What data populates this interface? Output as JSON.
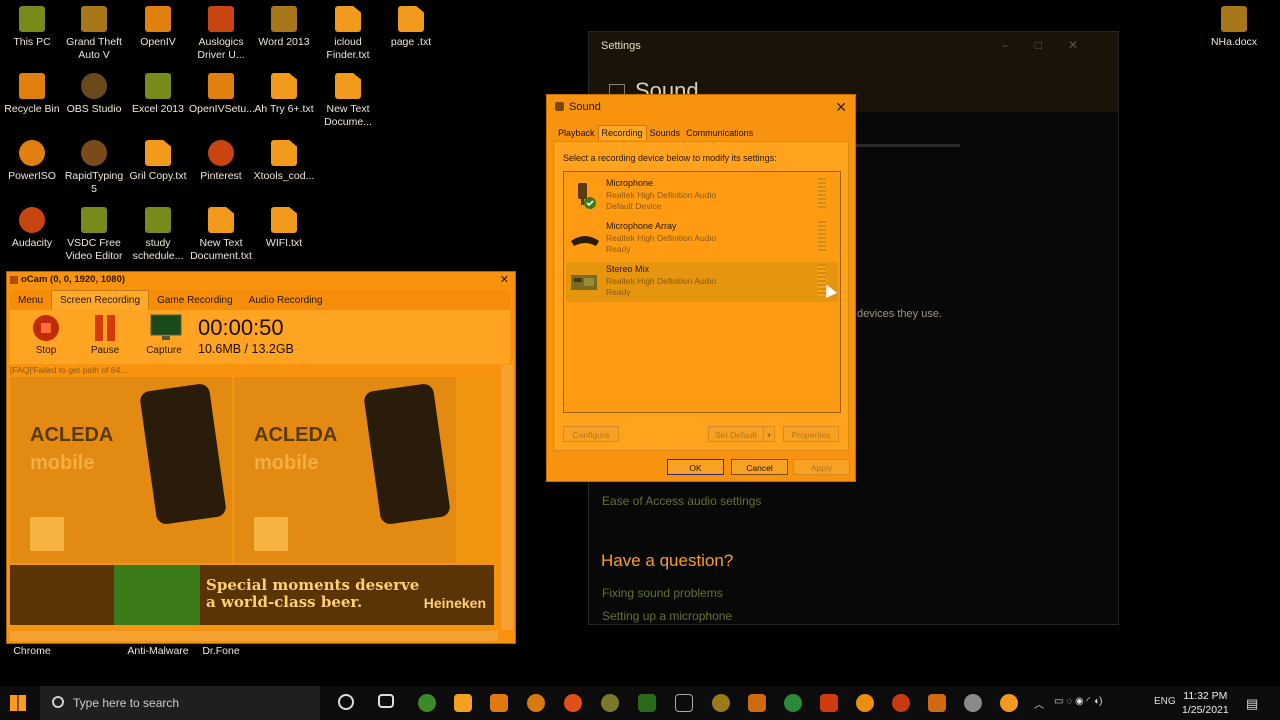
{
  "desktop": {
    "icons": [
      {
        "label": "This PC"
      },
      {
        "label": "Grand Theft Auto V"
      },
      {
        "label": "OpenIV"
      },
      {
        "label": "Auslogics Driver U..."
      },
      {
        "label": "Word 2013"
      },
      {
        "label": "icloud Finder.txt"
      },
      {
        "label": "page .txt"
      },
      {
        "label": "Recycle Bin"
      },
      {
        "label": "OBS Studio"
      },
      {
        "label": "Excel 2013"
      },
      {
        "label": "OpenIVSetu..."
      },
      {
        "label": "Ah Try 6+.txt"
      },
      {
        "label": "New Text Docume..."
      },
      {
        "label": "PowerISO"
      },
      {
        "label": "RapidTyping 5"
      },
      {
        "label": "Gril Copy.txt"
      },
      {
        "label": "Pinterest"
      },
      {
        "label": "Xtools_cod..."
      },
      {
        "label": "Audacity"
      },
      {
        "label": "VSDC Free Video Editor"
      },
      {
        "label": "study schedule..."
      },
      {
        "label": "New Text Document.txt"
      },
      {
        "label": "WIFI.txt"
      },
      {
        "label": "NHa.docx"
      },
      {
        "label": "Chrome"
      },
      {
        "label": "Anti-Malware"
      },
      {
        "label": "Dr.Fone"
      }
    ]
  },
  "settings": {
    "title": "Settings",
    "page_title": "Sound",
    "desc_tail": "devices they use.",
    "ease_link": "Ease of Access audio settings",
    "question_heading": "Have a question?",
    "help_links": [
      "Fixing sound problems",
      "Setting up a microphone"
    ]
  },
  "sound_dialog": {
    "title": "Sound",
    "tabs": [
      "Playback",
      "Recording",
      "Sounds",
      "Communications"
    ],
    "active_tab": "Recording",
    "instruction": "Select a recording device below to modify its settings:",
    "devices": [
      {
        "name": "Microphone",
        "driver": "Realtek High Definition Audio",
        "status": "Default Device"
      },
      {
        "name": "Microphone Array",
        "driver": "Realtek High Definition Audio",
        "status": "Ready"
      },
      {
        "name": "Stereo Mix",
        "driver": "Realtek High Definition Audio",
        "status": "Ready"
      }
    ],
    "buttons": {
      "configure": "Configure",
      "set_default": "Set Default",
      "properties": "Properties",
      "ok": "OK",
      "cancel": "Cancel",
      "apply": "Apply"
    }
  },
  "ocam": {
    "title": "oCam (0, 0, 1920, 1080)",
    "menu": [
      "Menu",
      "Screen Recording",
      "Game Recording",
      "Audio Recording"
    ],
    "active_menu": "Screen Recording",
    "tools": {
      "stop": "Stop",
      "pause": "Pause",
      "capture": "Capture"
    },
    "timer": "00:00:50",
    "size": "10.6MB / 13.2GB",
    "faq": "[FAQ]'Failed to get path of 64...",
    "ads": {
      "acleda_brand": "ACLEDA",
      "acleda_mobile": "mobile",
      "heineken_slogan": [
        "Special moments deserve",
        "a world-class beer."
      ],
      "heineken_logo": "Heineken"
    }
  },
  "taskbar": {
    "search_placeholder": "Type here to search",
    "language": "ENG",
    "time": "11:32 PM",
    "date": "1/25/2021"
  }
}
